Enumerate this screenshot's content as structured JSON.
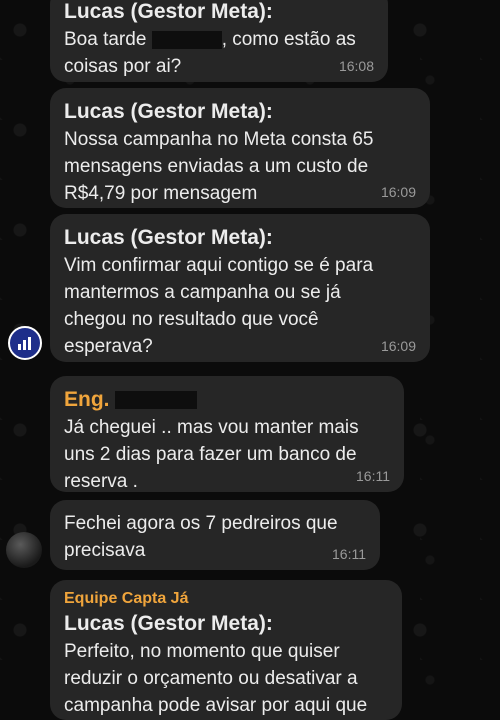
{
  "messages": [
    {
      "sender": "Lucas (Gestor Meta):",
      "text_before": "Boa tarde",
      "text_after": ", como estão as",
      "line2": "coisas por ai?",
      "time": "16:08"
    },
    {
      "sender": "Lucas (Gestor Meta):",
      "lines": [
        "Nossa campanha no Meta consta 65",
        "mensagens enviadas a um custo de",
        "R$4,79 por mensagem"
      ],
      "time": "16:09"
    },
    {
      "sender": "Lucas (Gestor Meta):",
      "lines": [
        "Vim confirmar aqui contigo se é para",
        "mantermos a campanha ou se já",
        "chegou no resultado que você",
        "esperava?"
      ],
      "time": "16:09"
    },
    {
      "sender": "Eng.",
      "lines": [
        "Já cheguei .. mas vou manter mais",
        "uns 2 dias para fazer um banco de",
        "reserva ."
      ],
      "time": "16:11"
    },
    {
      "lines": [
        "Fechei agora os 7 pedreiros que",
        "precisava"
      ],
      "time": "16:11"
    },
    {
      "group": "Equipe Capta Já",
      "sender": "Lucas (Gestor Meta):",
      "lines": [
        "Perfeito, no momento que quiser",
        "reduzir o orçamento ou desativar a",
        "campanha pode avisar por aqui que"
      ]
    }
  ],
  "colors": {
    "bubble": "#262626",
    "accent": "#f0a53c",
    "avatar": "#1e2e8a"
  },
  "icons": {
    "avatar_1": "chart-logo-icon",
    "avatar_2": "profile-photo-icon"
  }
}
